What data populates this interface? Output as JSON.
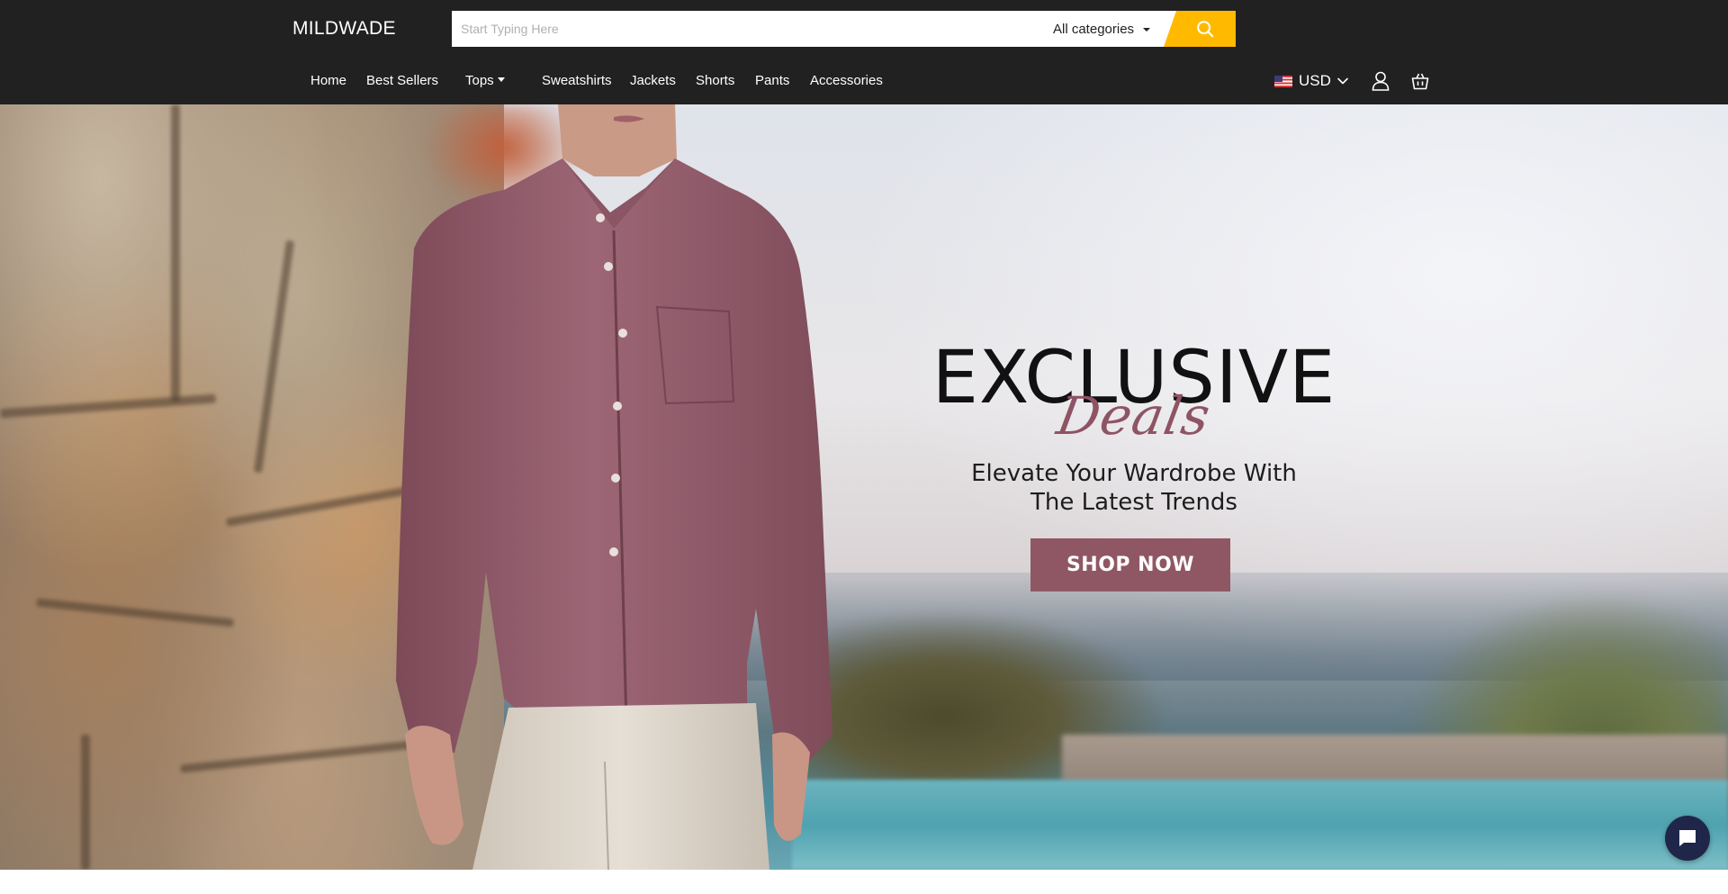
{
  "header": {
    "logo": "MILDWADE",
    "search": {
      "placeholder": "Start Typing Here",
      "category": "All categories",
      "icon": "search-icon"
    },
    "nav": [
      {
        "label": "Home"
      },
      {
        "label": "Best Sellers"
      },
      {
        "label": "Tops"
      },
      {
        "label": "Sweatshirts"
      },
      {
        "label": "Jackets"
      },
      {
        "label": "Shorts"
      },
      {
        "label": "Pants"
      },
      {
        "label": "Accessories"
      }
    ],
    "currency": {
      "label": "USD",
      "flag": "us-flag-icon"
    },
    "icons": {
      "user": "user-icon",
      "cart": "shopping-bag-icon"
    }
  },
  "hero": {
    "title": "EXCLUSIVE",
    "script": "Deals",
    "subtitle_line1": "Elevate Your Wardrobe With",
    "subtitle_line2": "The Latest Trends",
    "cta": "SHOP NOW"
  },
  "chat": {
    "icon": "chat-bubble-icon"
  },
  "colors": {
    "header_bg": "#212121",
    "search_button": "#ffba00",
    "accent": "#8f5764",
    "chat_button": "#20264a"
  }
}
